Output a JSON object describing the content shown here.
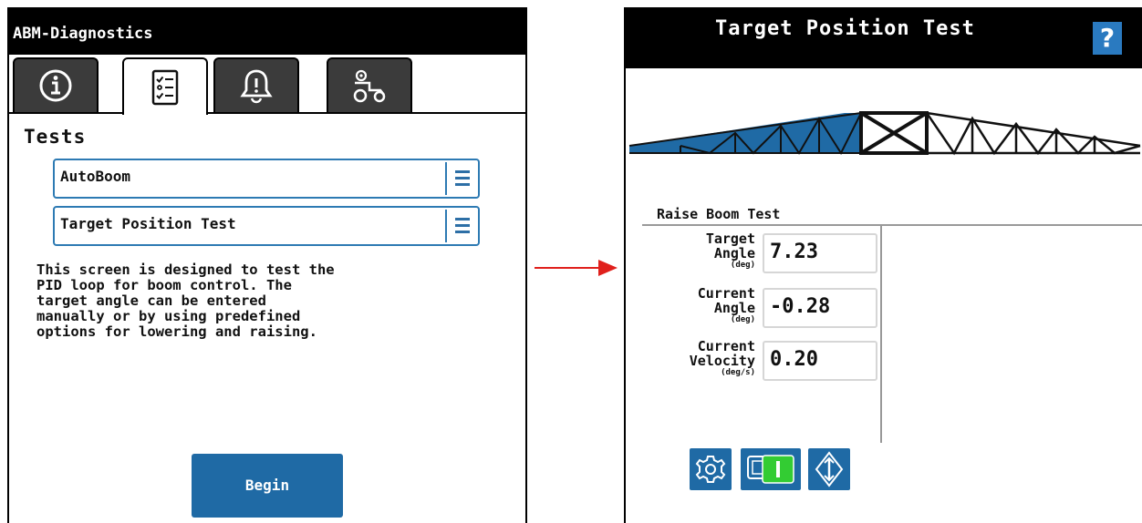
{
  "left_screen": {
    "title": "ABM-Diagnostics",
    "tabs": [
      {
        "icon": "info-icon",
        "active": false
      },
      {
        "icon": "checklist-icon",
        "active": true
      },
      {
        "icon": "alarm-bell-icon",
        "active": false
      },
      {
        "icon": "tractor-settings-icon",
        "active": false
      }
    ],
    "heading": "Tests",
    "system_select": {
      "value": "AutoBoom"
    },
    "test_select": {
      "value": "Target Position Test"
    },
    "description": "This screen is designed to test the\nPID loop for boom control. The\ntarget angle can be entered\nmanually or by using predefined\noptions for lowering and raising.",
    "begin_button": "Begin"
  },
  "arrow": {
    "color": "#e0201c"
  },
  "right_screen": {
    "title": "Target Position Test",
    "help_label": "?",
    "panel_title": "Raise Boom Test",
    "readouts": [
      {
        "label_line1": "Target",
        "label_line2": "Angle",
        "unit": "(deg)",
        "value": "7.23"
      },
      {
        "label_line1": "Current",
        "label_line2": "Angle",
        "unit": "(deg)",
        "value": "-0.28"
      },
      {
        "label_line1": "Current",
        "label_line2": "Velocity",
        "unit": "(deg/s)",
        "value": "0.20"
      }
    ],
    "toolbar_icons": [
      "settings-gear-icon",
      "toggle-switch-icon",
      "boom-direction-icon"
    ]
  },
  "colors": {
    "accent_blue": "#1f6aa5",
    "select_border": "#2d7ab3",
    "toggle_green": "#33cc33",
    "arrow_red": "#e0201c"
  }
}
